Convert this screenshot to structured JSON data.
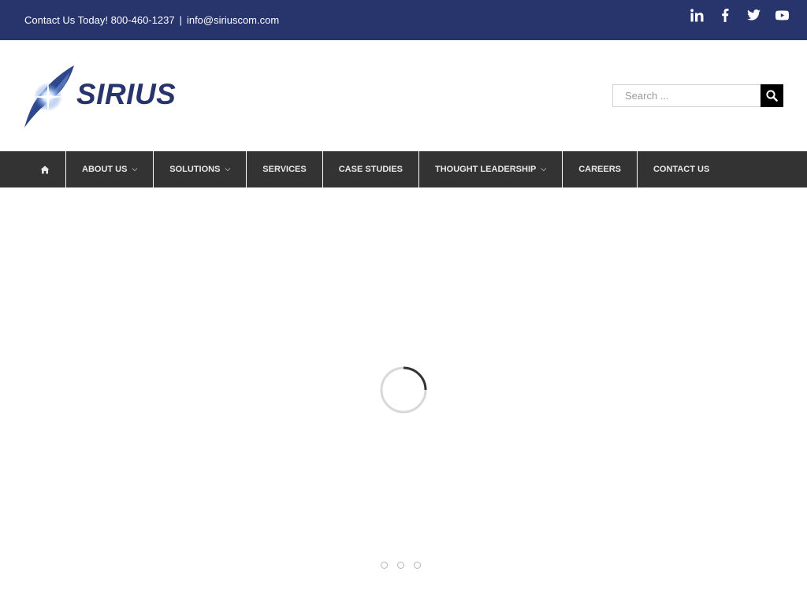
{
  "topbar": {
    "contact_prefix": "Contact Us Today! 800-460-1237",
    "separator": "|",
    "email": "info@siriuscom.com",
    "social": [
      "linkedin-icon",
      "facebook-icon",
      "twitter-icon",
      "youtube-icon"
    ]
  },
  "logo": {
    "text": "SIRIUS"
  },
  "search": {
    "placeholder": "Search ..."
  },
  "nav": {
    "items": [
      {
        "label": "ABOUT US",
        "has_dropdown": true
      },
      {
        "label": "SOLUTIONS",
        "has_dropdown": true
      },
      {
        "label": "SERVICES",
        "has_dropdown": false
      },
      {
        "label": "CASE STUDIES",
        "has_dropdown": false
      },
      {
        "label": "THOUGHT LEADERSHIP",
        "has_dropdown": true
      },
      {
        "label": "CAREERS",
        "has_dropdown": false
      },
      {
        "label": "CONTACT US",
        "has_dropdown": false
      }
    ],
    "chevron": "⌵"
  },
  "slider": {
    "slide_count": 3
  },
  "colors": {
    "brand_navy": "#28346c",
    "nav_bg": "#333333",
    "search_button": "#000000"
  }
}
